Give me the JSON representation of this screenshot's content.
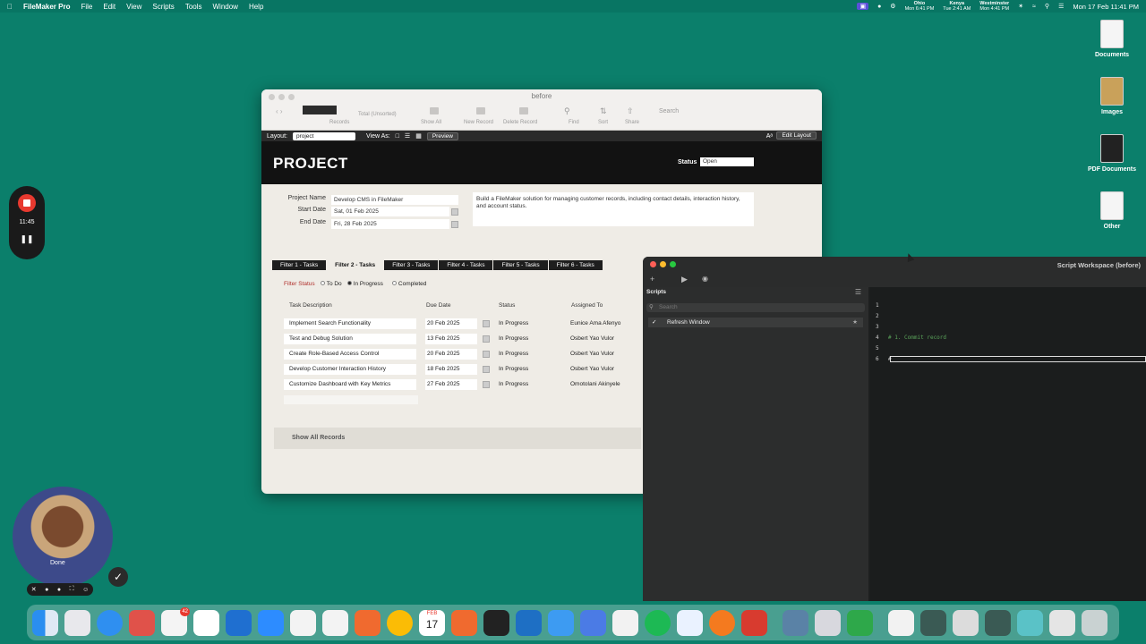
{
  "menubar": {
    "app": "FileMaker Pro",
    "items": [
      "File",
      "Edit",
      "View",
      "Scripts",
      "Tools",
      "Window",
      "Help"
    ],
    "clocks": [
      {
        "city": "Ohio",
        "time": "Mon 6:41 PM"
      },
      {
        "city": "Kenya",
        "time": "Tue 2:41 AM"
      },
      {
        "city": "Westminster",
        "time": "Mon 4:41 PM"
      }
    ],
    "datetime": "Mon 17 Feb 11:41 PM"
  },
  "desktop": {
    "icons": [
      "Documents",
      "Images",
      "PDF Documents",
      "Other"
    ]
  },
  "fm_window": {
    "title": "before",
    "toolbar": {
      "total": "Total (Unsorted)",
      "records": "Records",
      "show_all": "Show All",
      "new_record": "New Record",
      "delete_record": "Delete Record",
      "find": "Find",
      "sort": "Sort",
      "share": "Share",
      "search_placeholder": "Search"
    },
    "layout_bar": {
      "layout_label": "Layout:",
      "layout_value": "project",
      "view_as": "View As:",
      "preview": "Preview",
      "edit_layout": "Edit Layout"
    },
    "header": {
      "title": "PROJECT",
      "status_label": "Status",
      "status_value": "Open"
    },
    "fields": {
      "project_name_label": "Project Name",
      "project_name": "Develop CMS in FileMaker",
      "start_date_label": "Start Date",
      "start_date": "Sat, 01 Feb 2025",
      "end_date_label": "End Date",
      "end_date": "Fri, 28 Feb 2025",
      "description": "Build a FileMaker solution for managing customer records, including contact details, interaction history, and account status."
    },
    "tabs": [
      "Filter 1 - Tasks",
      "Filter 2 - Tasks",
      "Filter 3 - Tasks",
      "Filter 4 - Tasks",
      "Filter 5 - Tasks",
      "Filter 6 - Tasks"
    ],
    "filter": {
      "label": "Filter Status",
      "options": [
        "To Do",
        "In Progress",
        "Completed"
      ],
      "selected": "In Progress"
    },
    "table": {
      "headers": [
        "Task Description",
        "Due Date",
        "Status",
        "Assigned To"
      ],
      "rows": [
        [
          "Implement Search Functionality",
          "20 Feb 2025",
          "In Progress",
          "Eunice Ama Afenyo"
        ],
        [
          "Test and Debug Solution",
          "13 Feb 2025",
          "In Progress",
          "Osbert Yao Vulor"
        ],
        [
          "Create Role-Based Access Control",
          "20 Feb 2025",
          "In Progress",
          "Osbert Yao Vulor"
        ],
        [
          "Develop Customer Interaction History",
          "18 Feb 2025",
          "In Progress",
          "Osbert Yao Vulor"
        ],
        [
          "Customize Dashboard with Key Metrics",
          "27 Feb 2025",
          "In Progress",
          "Omotolani Akinyele"
        ]
      ]
    },
    "show_all_records": "Show All Records"
  },
  "script_workspace": {
    "title": "Script Workspace (before)",
    "scripts_header": "Scripts",
    "search_placeholder": "Search",
    "script_item": "Refresh Window",
    "line_numbers": [
      "1",
      "2",
      "3",
      "4",
      "5",
      "6"
    ],
    "code_line_4": "# 1. Commit record",
    "code_line_6": "#"
  },
  "recording": {
    "time": "11:45"
  },
  "camera": {
    "label": "Done"
  },
  "dock": {
    "slack_badge": "42",
    "calendar_month": "FEB",
    "calendar_day": "17"
  }
}
